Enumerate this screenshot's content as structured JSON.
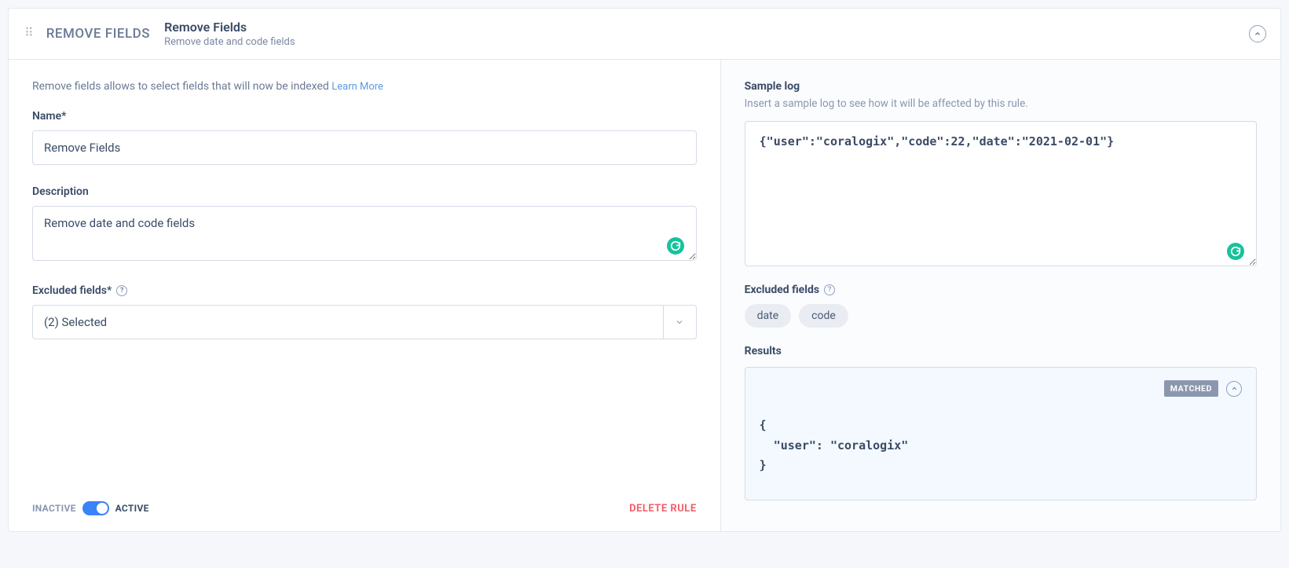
{
  "header": {
    "rule_type": "REMOVE FIELDS",
    "title": "Remove Fields",
    "subtitle": "Remove date and code fields"
  },
  "left": {
    "intro_text": "Remove fields allows to select fields that will now be indexed ",
    "learn_more": "Learn More",
    "name_label": "Name*",
    "name_value": "Remove Fields",
    "description_label": "Description",
    "description_value": "Remove date and code fields",
    "excluded_label": "Excluded fields*",
    "excluded_value": "(2) Selected",
    "inactive_label": "INACTIVE",
    "active_label": "ACTIVE",
    "delete_label": "DELETE RULE"
  },
  "right": {
    "sample_title": "Sample log",
    "sample_hint": "Insert a sample log to see how it will be affected by this rule.",
    "sample_value": "{\"user\":\"coralogix\",\"code\":22,\"date\":\"2021-02-01\"}",
    "excluded_title": "Excluded fields",
    "chips": [
      "date",
      "code"
    ],
    "results_title": "Results",
    "matched_badge": "MATCHED",
    "results_code": "{\n  \"user\": \"coralogix\"\n}"
  }
}
